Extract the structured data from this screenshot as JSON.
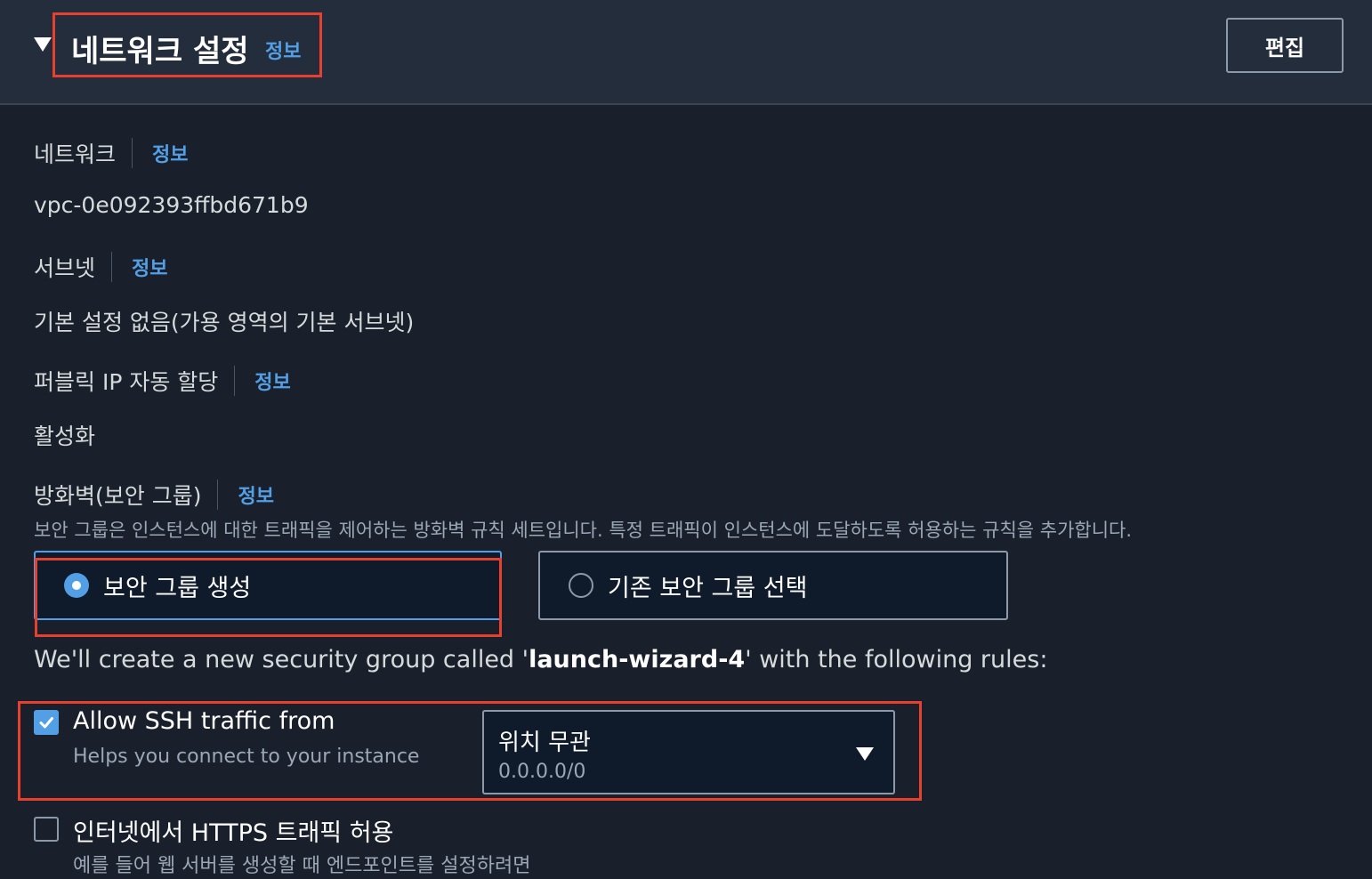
{
  "section": {
    "title": "네트워크 설정",
    "info": "정보",
    "edit_label": "편집"
  },
  "fields": {
    "network": {
      "label": "네트워크",
      "info": "정보",
      "value": "vpc-0e092393ffbd671b9"
    },
    "subnet": {
      "label": "서브넷",
      "info": "정보",
      "value": "기본 설정 없음(가용 영역의 기본 서브넷)"
    },
    "public_ip": {
      "label": "퍼블릭 IP 자동 할당",
      "info": "정보",
      "value": "활성화"
    },
    "firewall": {
      "label": "방화벽(보안 그룹)",
      "info": "정보",
      "description": "보안 그룹은 인스턴스에 대한 트래픽을 제어하는 방화벽 규칙 세트입니다. 특정 트래픽이 인스턴스에 도달하도록 허용하는 규칙을 추가합니다.",
      "options": [
        {
          "label": "보안 그룹 생성",
          "selected": true
        },
        {
          "label": "기존 보안 그룹 선택",
          "selected": false
        }
      ]
    }
  },
  "wizard": {
    "prefix": "We'll create a new security group called '",
    "group_name": "launch-wizard-4",
    "suffix": "' with the following rules:"
  },
  "rules": {
    "ssh": {
      "checked": true,
      "label": "Allow SSH traffic from",
      "help": "Helps you connect to your instance",
      "select_value": "위치 무관",
      "select_sub": "0.0.0.0/0"
    },
    "https": {
      "checked": false,
      "label": "인터넷에서 HTTPS 트래픽 허용",
      "help": "예를 들어 웹 서버를 생성할 때 엔드포인트를 설정하려면"
    }
  },
  "colors": {
    "accent": "#539fe5",
    "annotation": "#e8402f",
    "background": "#1a202b",
    "header_bg": "#242d3b"
  }
}
